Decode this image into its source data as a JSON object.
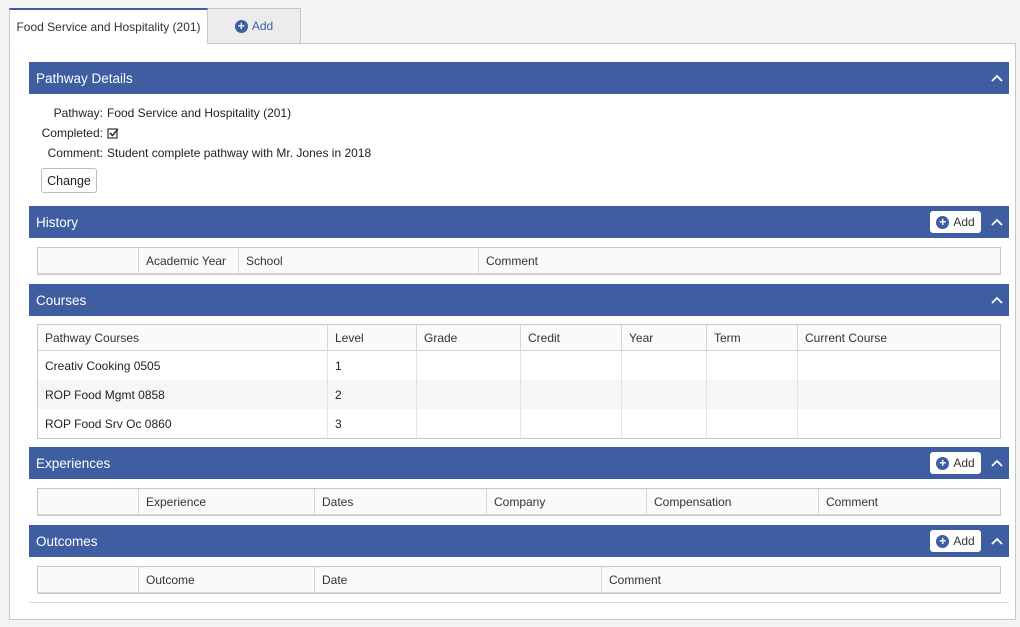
{
  "tabs": {
    "active_label": "Food Service and Hospitality (201)",
    "add_label": "Add"
  },
  "pathway_details": {
    "title": "Pathway Details",
    "pathway_label": "Pathway:",
    "pathway_value": "Food Service and Hospitality (201)",
    "completed_label": "Completed:",
    "completed_checked": true,
    "comment_label": "Comment:",
    "comment_value": "Student complete pathway with Mr. Jones in 2018",
    "change_button": "Change"
  },
  "history": {
    "title": "History",
    "add_label": "Add",
    "columns": [
      "",
      "Academic Year",
      "School",
      "Comment"
    ]
  },
  "courses": {
    "title": "Courses",
    "columns": [
      "Pathway Courses",
      "Level",
      "Grade",
      "Credit",
      "Year",
      "Term",
      "Current Course"
    ],
    "rows": [
      [
        "Creativ Cooking 0505",
        "1",
        "",
        "",
        "",
        "",
        ""
      ],
      [
        "ROP Food Mgmt 0858",
        "2",
        "",
        "",
        "",
        "",
        ""
      ],
      [
        "ROP Food Srv Oc 0860",
        "3",
        "",
        "",
        "",
        "",
        ""
      ]
    ]
  },
  "experiences": {
    "title": "Experiences",
    "add_label": "Add",
    "columns": [
      "",
      "Experience",
      "Dates",
      "Company",
      "Compensation",
      "Comment"
    ]
  },
  "outcomes": {
    "title": "Outcomes",
    "add_label": "Add",
    "columns": [
      "",
      "Outcome",
      "Date",
      "Comment"
    ]
  },
  "colors": {
    "header_blue": "#3f5ea1"
  }
}
